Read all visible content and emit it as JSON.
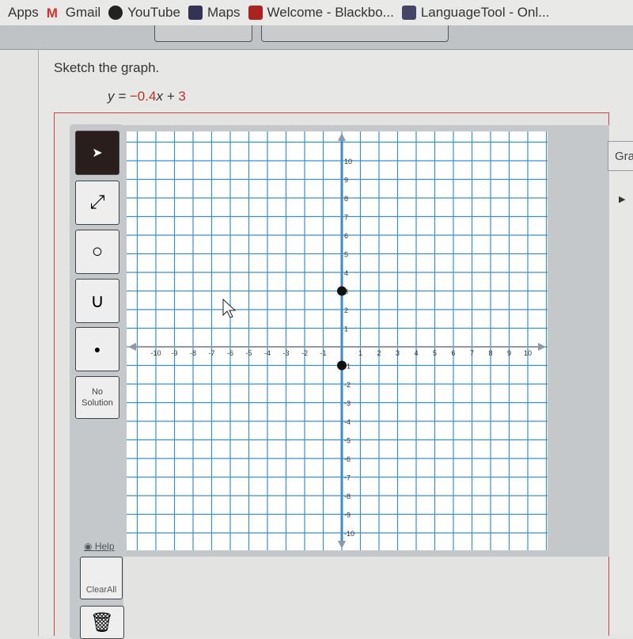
{
  "bookmarks": [
    "Apps",
    "Gmail",
    "YouTube",
    "Maps",
    "Welcome - Blackbo...",
    "LanguageTool - Onl..."
  ],
  "question": {
    "prompt": "Sketch the graph.",
    "eq_lhs": "y = ",
    "eq_slope": "−0.4",
    "eq_x": "x + ",
    "eq_intercept": "3"
  },
  "tools": {
    "select": "select-arrow",
    "line": "line-tool",
    "circle": "circle-tool",
    "parabola": "parabola-tool",
    "point": "point-tool",
    "no_solution": "No Solution",
    "help": "Help",
    "clear_all": "ClearAll",
    "delete": "trash"
  },
  "side_tab": "Gra",
  "chart_data": {
    "type": "scatter",
    "xlim": [
      -10,
      10
    ],
    "ylim": [
      -10,
      10
    ],
    "x_ticks": [
      -10,
      -9,
      -8,
      -7,
      -6,
      -5,
      -4,
      -3,
      -2,
      -1,
      1,
      2,
      3,
      4,
      5,
      6,
      7,
      8,
      9,
      10
    ],
    "y_ticks": [
      -10,
      -9,
      -8,
      -7,
      -6,
      -5,
      -4,
      -3,
      -2,
      -1,
      1,
      2,
      3,
      4,
      5,
      6,
      7,
      8,
      9,
      10
    ],
    "grid": true,
    "points": [
      {
        "x": 0,
        "y": 3
      },
      {
        "x": 0,
        "y": -1
      }
    ],
    "colors": {
      "grid": "#3d8fc4",
      "axis": "#8a9aa8",
      "points": "#111111"
    }
  }
}
